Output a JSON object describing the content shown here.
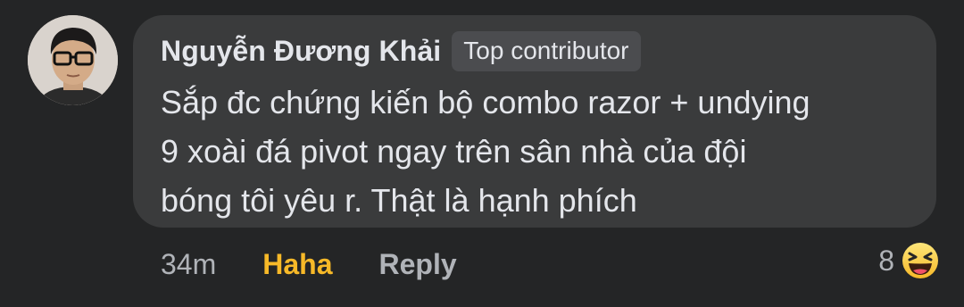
{
  "comment": {
    "author": "Nguyễn Đương Khải",
    "badge": "Top contributor",
    "text": "Sắp đc chứng kiến bộ combo razor + undying\n9 xoài đá pivot ngay trên sân nhà của đội\nbóng tôi yêu r. Thật là hạnh phích"
  },
  "actions": {
    "time": "34m",
    "reaction_label": "Haha",
    "reply_label": "Reply"
  },
  "reactions": {
    "count": "8",
    "icon": "haha-emoji-icon"
  },
  "colors": {
    "background": "#242526",
    "bubble": "#3a3b3c",
    "haha_accent": "#f7b928"
  }
}
